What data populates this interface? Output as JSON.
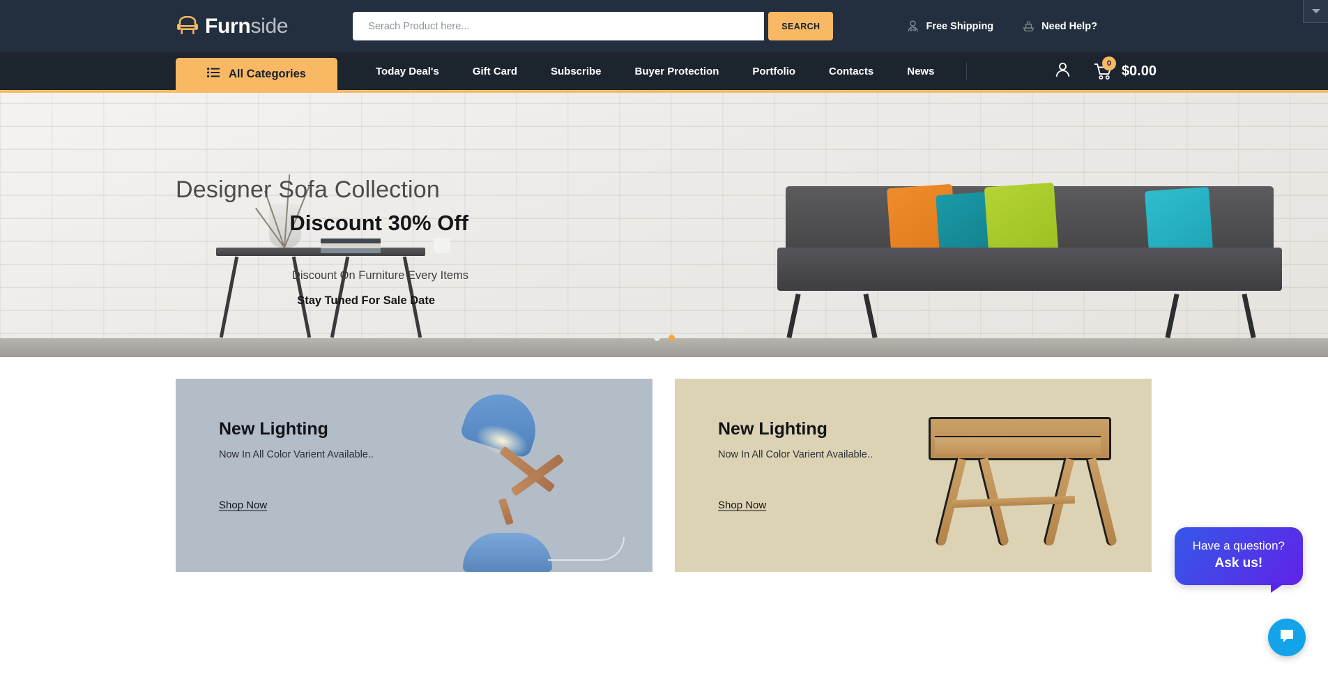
{
  "header": {
    "logo": {
      "icon": "sofa-icon",
      "text_bold": "Furn",
      "text_light": "side"
    },
    "search": {
      "placeholder": "Serach Product here...",
      "value": "",
      "button_label": "SEARCH"
    },
    "links": [
      {
        "icon": "shipping-person-icon",
        "label": "Free Shipping"
      },
      {
        "icon": "ship-icon",
        "label": "Need Help?"
      }
    ],
    "corner_dropdown_icon": "chevron-down-icon"
  },
  "nav": {
    "all_categories": {
      "icon": "list-icon",
      "label": "All Categories"
    },
    "items": [
      {
        "label": "Today Deal's"
      },
      {
        "label": "Gift Card"
      },
      {
        "label": "Subscribe"
      },
      {
        "label": "Buyer Protection"
      },
      {
        "label": "Portfolio"
      },
      {
        "label": "Contacts"
      },
      {
        "label": "News"
      }
    ],
    "account_icon": "user-icon",
    "cart": {
      "icon": "cart-icon",
      "count": "0",
      "total": "$0.00"
    }
  },
  "hero": {
    "title": "Designer Sofa Collection",
    "subtitle": "Discount 30% Off",
    "line1": "Discount On Furniture Every Items",
    "line2": "Stay Tuned For Sale Date",
    "dots": [
      {
        "active": false
      },
      {
        "active": true
      }
    ]
  },
  "promos": [
    {
      "title": "New Lighting",
      "desc": "Now In All Color Varient Available..",
      "link": "Shop Now",
      "background": "#b3bdc8",
      "image": "desk-lamp-image"
    },
    {
      "title": "New Lighting",
      "desc": "Now In All Color Varient Available..",
      "link": "Shop Now",
      "background": "#dcd3b5",
      "image": "wooden-desk-image"
    }
  ],
  "chat": {
    "question": "Have a question?",
    "cta": "Ask us!",
    "launcher_icon": "chat-bubble-icon"
  },
  "colors": {
    "header_bg": "#232F3E",
    "nav_bg": "#1C242E",
    "accent": "#F9B864",
    "chat_gradient_start": "#3558e8",
    "chat_gradient_end": "#6023e8",
    "launcher": "#12A3E8"
  }
}
